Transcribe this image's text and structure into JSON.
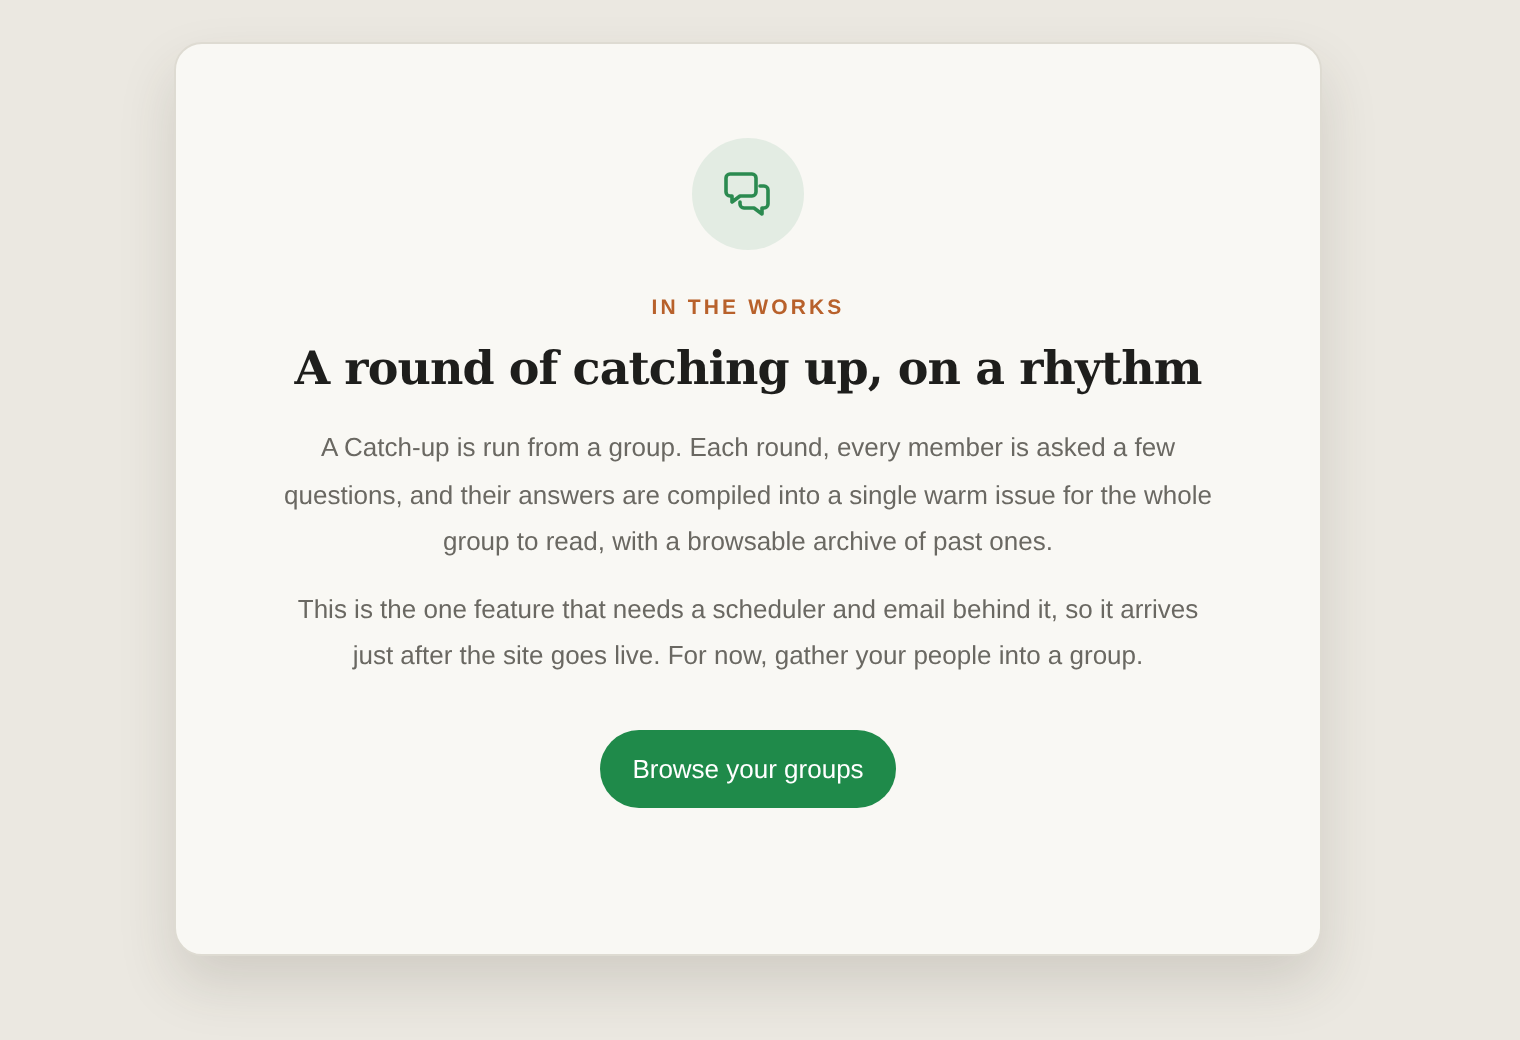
{
  "card": {
    "eyebrow": "IN THE WORKS",
    "title": "A round of catching up, on a rhythm",
    "paragraphs": [
      "A Catch-up is run from a group. Each round, every member is asked a few questions, and their answers are compiled into a single warm issue for the whole group to read, with a browsable archive of past ones.",
      "This is the one feature that needs a scheduler and email behind it, so it arrives just after the site goes live. For now, gather your people into a group."
    ],
    "button": "Browse your groups"
  }
}
